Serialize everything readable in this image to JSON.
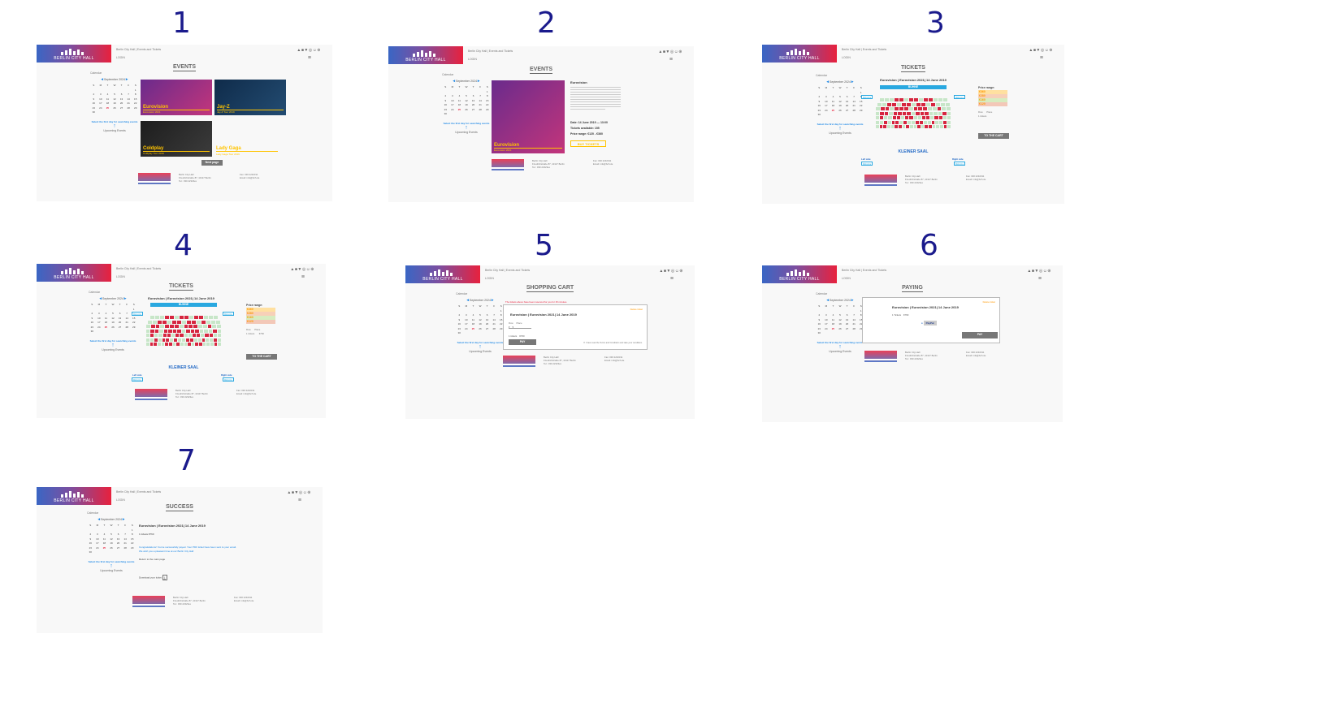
{
  "screens": [
    {
      "id": 1,
      "number": "1",
      "crumb": "Berlin City Hall | Events and Tickets",
      "title": "EVENTS"
    },
    {
      "id": 2,
      "number": "2",
      "crumb": "Berlin City Hall | Events and Tickets",
      "title": "EVENTS"
    },
    {
      "id": 3,
      "number": "3",
      "crumb": "Berlin City Hall | Events and Tickets",
      "title": "TICKETS"
    },
    {
      "id": 4,
      "number": "4",
      "crumb": "Berlin City Hall | Events and Tickets",
      "title": "TICKETS"
    },
    {
      "id": 5,
      "number": "5",
      "crumb": "Berlin City Hall | Events and Tickets",
      "title": "SHOPPING CART"
    },
    {
      "id": 6,
      "number": "6",
      "crumb": "Berlin City Hall | Events and Tickets",
      "title": "PAYING"
    },
    {
      "id": 7,
      "number": "7",
      "crumb": "Berlin City Hall | Events and Tickets",
      "title": "SUCCESS"
    }
  ],
  "common": {
    "logo_text": "BERLIN CITY HALL",
    "login": "LOGIN",
    "social": "▲■▼◎☺⊕",
    "menu_icon": "≡",
    "calendar_caption": "Calendar",
    "calendar_month": "September 2024",
    "weekdays": [
      "S",
      "M",
      "T",
      "W",
      "T",
      "F",
      "S"
    ],
    "days": [
      "",
      "",
      "",
      "",
      "",
      "",
      "1",
      "2",
      "3",
      "4",
      "5",
      "6",
      "7",
      "8",
      "9",
      "10",
      "11",
      "12",
      "13",
      "14",
      "15",
      "16",
      "17",
      "18",
      "19",
      "20",
      "21",
      "22",
      "23",
      "24",
      "25",
      "26",
      "27",
      "28",
      "29",
      "30"
    ],
    "calendar_hint": "Select the first day for searching events",
    "upcoming": "Upcoming Events",
    "footer_address": "Berlin City Hall\nFriedrichstraße 87, 10117 Berlin\nTel.: 030 22323ex",
    "footer_contact": "Fax: 030 2232311\nEmail: info@bch.de"
  },
  "events": [
    {
      "name": "Eurovision",
      "date": "Eurovision 2021"
    },
    {
      "name": "Jay-Z",
      "date": "Jay-Z Tour 2019"
    },
    {
      "name": "Coldplay",
      "date": "Coldplay Tour 2019"
    },
    {
      "name": "Lady Gaga",
      "date": "Lady Gaga Tour 2019"
    }
  ],
  "next_page": "Next page",
  "event_detail": {
    "name": "Eurovision",
    "date_label": "Date: 14 June 2019 — 13:00",
    "tickets_label": "Tickets available: 155",
    "price_label": "Price range: €120 - €360",
    "buy": "BUY TICKETS"
  },
  "tickets": {
    "heading": "Eurovision | Eurovision 2021| 14 June 2019",
    "stage": "BUHNE",
    "hall": "KLEINER SAAL",
    "left_side": "Left side",
    "right_side": "Right side",
    "price_title": "Price range:",
    "prices": [
      "€360",
      "€280",
      "€160",
      "€120"
    ],
    "price_colors": [
      "#ffe0a0",
      "#f7d0b8",
      "#d7ecc0",
      "#f3c8b8"
    ],
    "row_label": "Row",
    "place_label": "Place",
    "tickets_count": "1 tickets",
    "total": "€760",
    "to_cart": "TO THE CART"
  },
  "cart": {
    "warning": "The tickets above have been reserved for you for 15 minutes.",
    "heading": "Eurovision | Eurovision 2021| 14 June 2019",
    "delete": "Delete ticket",
    "row": "Row",
    "place": "Place",
    "summary": "1 tickets    €760",
    "pay": "PAY",
    "terms": "I have read the Terms and Conditions and take your conditions"
  },
  "paying": {
    "heading": "Eurovision | Eurovision 2021| 14 June 2019",
    "delete": "Delete ticket",
    "summary": "1 Tickets    €760",
    "paypal": "PayPal",
    "pay": "PAY"
  },
  "success": {
    "heading": "Eurovision | Eurovision 2021| 14 June 2019",
    "summary": "1 tickets  €760",
    "line1": "Congratulations! You've successfully payed. Your PDF ticket have been sent to your email.",
    "line2": "We wish you a pleasant time at our Berlin City Hall",
    "return": "Return to the main page",
    "download": "Download your ticket"
  }
}
